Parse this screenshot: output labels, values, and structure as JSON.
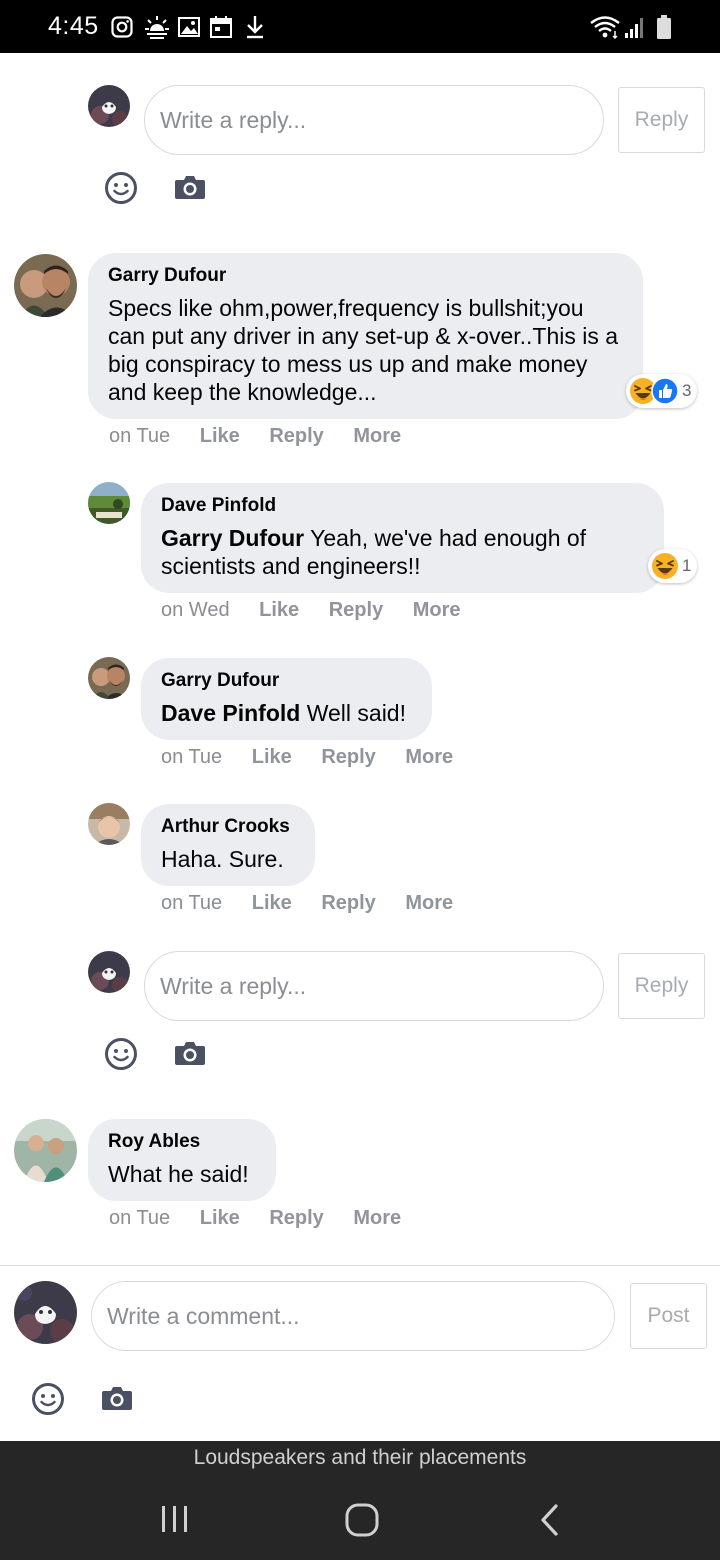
{
  "status_bar": {
    "time": "4:45",
    "icons": [
      "instagram-icon",
      "weather-icon",
      "gallery-icon",
      "calendar-icon",
      "download-icon",
      "wifi-icon",
      "signal-icon",
      "battery-icon"
    ]
  },
  "reply_composer_top": {
    "placeholder": "Write a reply...",
    "button": "Reply"
  },
  "comments": [
    {
      "author": "Garry Dufour",
      "text": "Specs like ohm,power,frequency is bullshit;you can put any driver in any set-up & x-over..This is a big conspiracy to mess us up and make money and keep the knowledge...",
      "time": "on Tue",
      "like": "Like",
      "reply": "Reply",
      "more": "More",
      "reactions": {
        "icons": [
          "haha-icon",
          "like-icon"
        ],
        "count": "3"
      }
    },
    {
      "author": "Dave Pinfold",
      "mention": "Garry Dufour",
      "text": "Yeah, we've had enough of scientists and engineers!!",
      "time": "on Wed",
      "like": "Like",
      "reply": "Reply",
      "more": "More",
      "reactions": {
        "icons": [
          "haha-icon"
        ],
        "count": "1"
      }
    },
    {
      "author": "Garry Dufour",
      "mention": "Dave Pinfold",
      "text": "Well said!",
      "time": "on Tue",
      "like": "Like",
      "reply": "Reply",
      "more": "More"
    },
    {
      "author": "Arthur Crooks",
      "text": "Haha. Sure.",
      "time": "on Tue",
      "like": "Like",
      "reply": "Reply",
      "more": "More"
    },
    {
      "author": "Roy Ables",
      "text": "What he said!",
      "time": "on Tue",
      "like": "Like",
      "reply": "Reply",
      "more": "More"
    }
  ],
  "reply_composer_bottom": {
    "placeholder": "Write a reply...",
    "button": "Reply"
  },
  "comment_composer": {
    "placeholder": "Write a comment...",
    "button": "Post"
  },
  "page_title": "Loudspeakers and their placements",
  "colors": {
    "bubble": "#ebedf0",
    "muted": "#8a8d91",
    "like_blue": "#1877f2",
    "haha_yellow": "#f7b125"
  }
}
